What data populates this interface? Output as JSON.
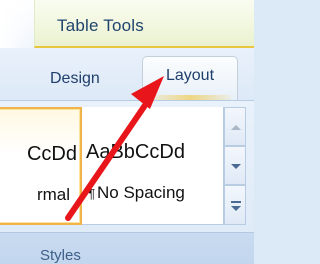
{
  "contextual_tab_group": {
    "title": "Table Tools",
    "accent_color": "#e8c640"
  },
  "tabs": [
    {
      "label": "Design",
      "selected": false
    },
    {
      "label": "Layout",
      "selected": true
    }
  ],
  "styles_gallery": {
    "items": [
      {
        "sample": "CcDd",
        "name": "rmal",
        "selected": true
      },
      {
        "sample": "AaBbCcDd",
        "name": "No Spacing",
        "selected": false,
        "marker": "¶"
      }
    ],
    "scroll_buttons": [
      "scroll-up-icon",
      "scroll-down-icon",
      "more-styles-icon"
    ]
  },
  "group": {
    "label": "Styles"
  },
  "annotation": {
    "type": "arrow",
    "color": "#e8161b"
  }
}
